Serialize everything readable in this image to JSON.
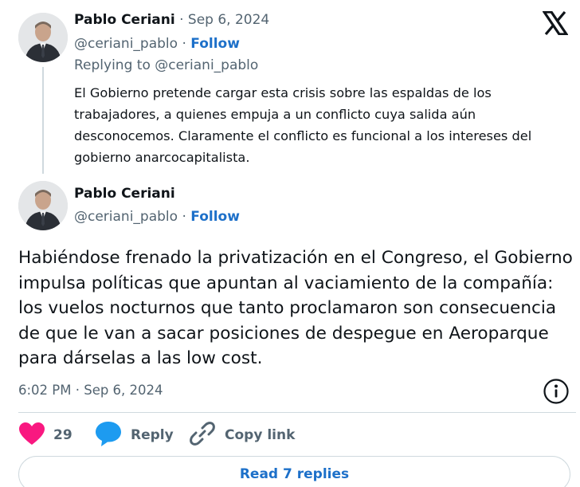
{
  "reply_tweet": {
    "author_name": "Pablo Ceriani",
    "separator": " · ",
    "date": "Sep 6, 2024",
    "handle": "@ceriani_pablo",
    "handle_separator": " · ",
    "follow_label": "Follow",
    "replying_to": "Replying to @ceriani_pablo",
    "text": "El Gobierno pretende cargar esta crisis sobre las espaldas de los trabajadores, a quienes empuja a un conflicto cuya salida aún desconocemos. Claramente el conflicto es funcional a los intereses del gobierno anarcocapitalista."
  },
  "main_tweet": {
    "author_name": "Pablo Ceriani",
    "handle": "@ceriani_pablo",
    "handle_separator": " · ",
    "follow_label": "Follow",
    "text": "Habiéndose frenado la privatización en el Congreso, el Gobierno impulsa políticas que apuntan al vaciamiento de la compañía: los vuelos nocturnos que tanto proclamaron son consecuencia de que le van a sacar posiciones de despegue en Aeroparque para dárselas a las low cost.",
    "timestamp": "6:02 PM · Sep 6, 2024"
  },
  "actions": {
    "like_count": "29",
    "reply_label": "Reply",
    "copy_link_label": "Copy link"
  },
  "read_replies_label": "Read 7 replies",
  "colors": {
    "link_blue": "#1d70c9",
    "heart_pink": "#f91880",
    "reply_bubble_blue": "#1d9bf0",
    "muted_gray": "#536471",
    "border_gray": "#cfd9de"
  },
  "icons": {
    "brand": "x-logo-icon",
    "like": "heart-icon",
    "reply": "speech-bubble-icon",
    "copy_link": "link-icon",
    "info": "info-icon"
  }
}
